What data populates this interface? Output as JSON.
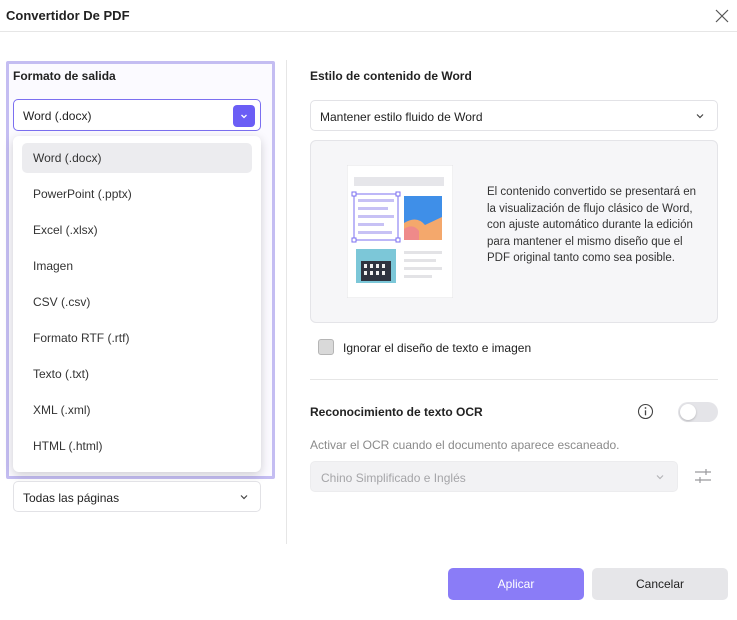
{
  "window": {
    "title": "Convertidor De PDF",
    "close_icon": "close-icon"
  },
  "left": {
    "output_format_label": "Formato de salida",
    "format_select": {
      "value": "Word (.docx)",
      "button_icon": "chevron-down-icon"
    },
    "format_menu": {
      "items": [
        {
          "label": "Word (.docx)",
          "selected": true
        },
        {
          "label": "PowerPoint (.pptx)",
          "selected": false
        },
        {
          "label": "Excel (.xlsx)",
          "selected": false
        },
        {
          "label": "Imagen",
          "selected": false
        },
        {
          "label": "CSV (.csv)",
          "selected": false
        },
        {
          "label": "Formato RTF (.rtf)",
          "selected": false
        },
        {
          "label": "Texto (.txt)",
          "selected": false
        },
        {
          "label": "XML (.xml)",
          "selected": false
        },
        {
          "label": "HTML (.html)",
          "selected": false
        }
      ]
    },
    "pages_select": {
      "value": "Todas las páginas",
      "icon": "chevron-down-icon"
    }
  },
  "right": {
    "word_style_label": "Estilo de contenido de Word",
    "style_select": {
      "value": "Mantener estilo fluido de Word",
      "icon": "chevron-down-icon"
    },
    "preview": {
      "description": "El contenido convertido se presentará en la visualización de flujo clásico de Word, con ajuste automático durante la edición para mantener el mismo diseño que el PDF original tanto como sea posible."
    },
    "ignore_layout": {
      "label": "Ignorar el diseño de texto e imagen",
      "checked": false
    },
    "ocr": {
      "label": "Reconocimiento de texto OCR",
      "info_icon": "info-icon",
      "enabled": false,
      "description": "Activar el OCR cuando el documento aparece escaneado.",
      "language_value": "Chino Simplificado e Inglés",
      "settings_icon": "sliders-icon"
    }
  },
  "footer": {
    "apply_label": "Aplicar",
    "cancel_label": "Cancelar"
  },
  "colors": {
    "accent": "#6b5ef5",
    "apply_button": "#8a7cf7",
    "highlight_border": "#c4bdf2"
  }
}
